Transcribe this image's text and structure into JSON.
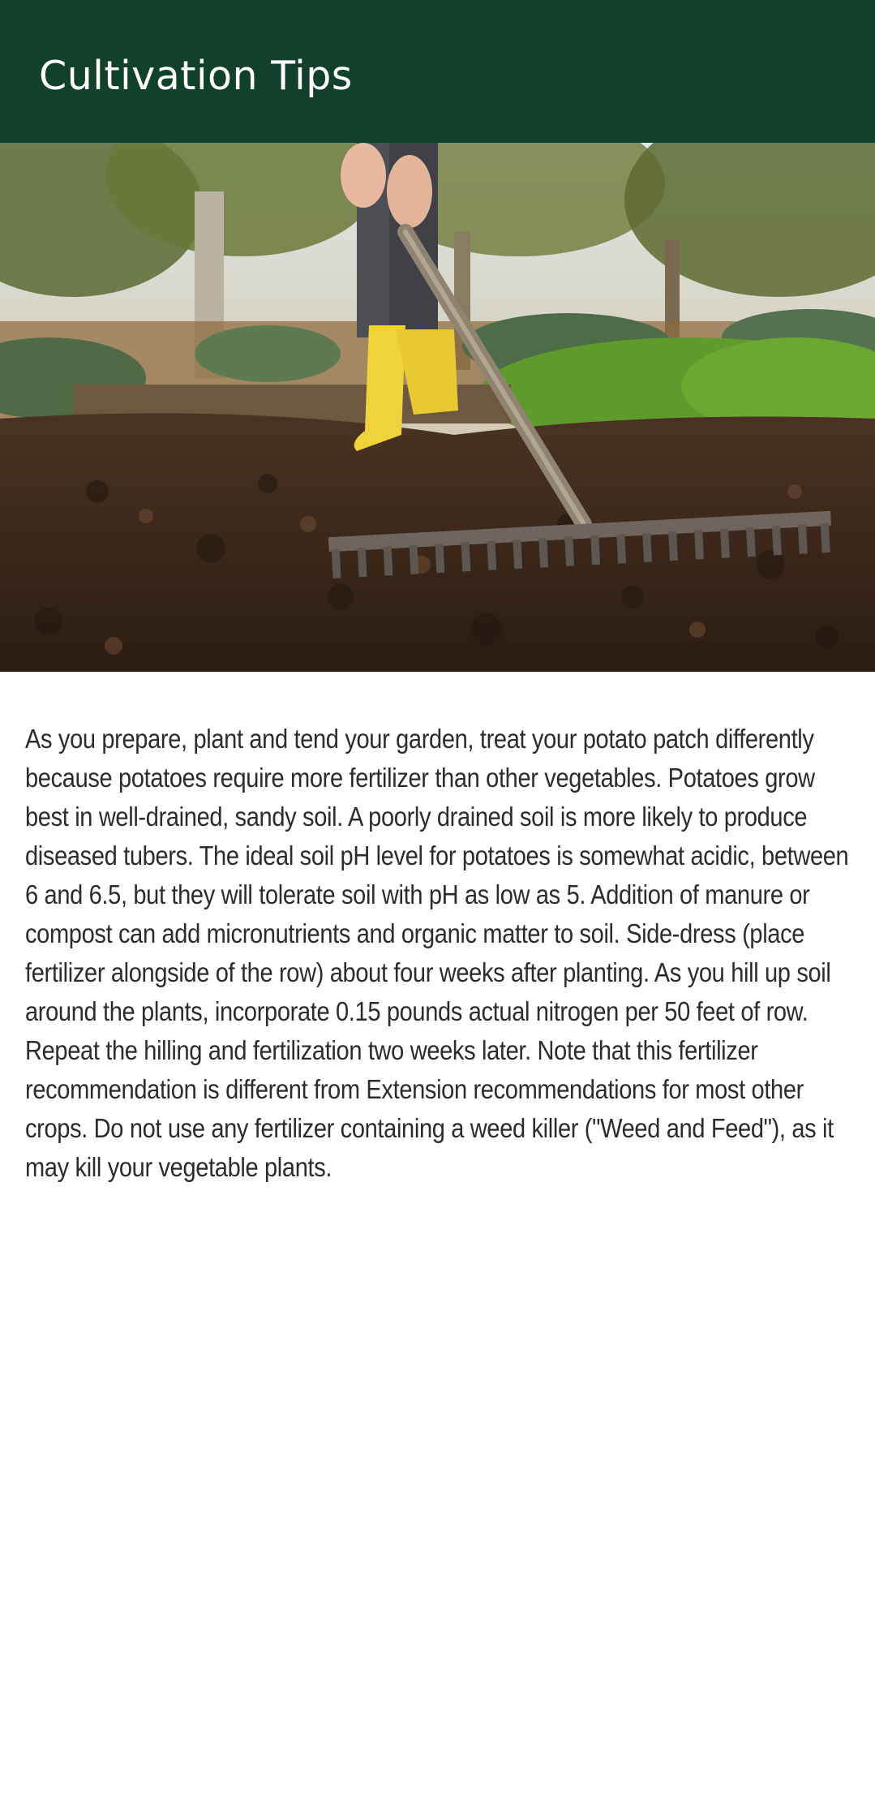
{
  "header": {
    "title": "Cultivation Tips",
    "background_color": "#11402c"
  },
  "hero_image": {
    "description_name": "garden-raking-photo"
  },
  "content": {
    "paragraph": "As you prepare, plant and tend your garden, treat your potato patch differently because potatoes require more fertilizer than other vegetables. Potatoes grow best in well-drained, sandy soil. A poorly drained soil is more likely to produce diseased tubers. The ideal soil pH level for potatoes is somewhat acidic, between 6 and 6.5, but they will tolerate soil with pH as low as 5. Addition of manure or compost can add micronutrients and organic matter to soil. Side-dress (place fertilizer alongside of the row) about four weeks after planting. As you hill up soil around the plants, incorporate 0.15 pounds actual nitrogen per 50 feet of row. Repeat the hilling and fertilization two weeks later. Note that this fertilizer recommendation is different from Extension recommendations for most other crops. Do not use any fertilizer containing a weed killer (\"Weed and Feed\"), as it may kill your vegetable plants."
  }
}
